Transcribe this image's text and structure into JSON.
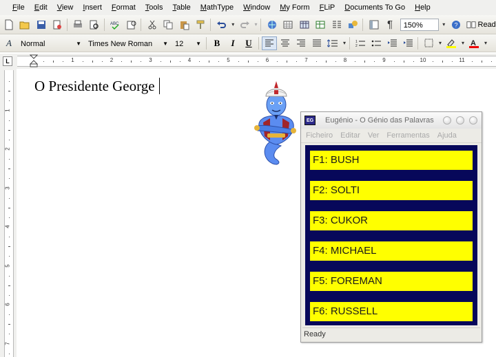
{
  "menubar": {
    "items": [
      "File",
      "Edit",
      "View",
      "Insert",
      "Format",
      "Tools",
      "Table",
      "MathType",
      "Window",
      "My Form",
      "FLiP",
      "Documents To Go",
      "Help"
    ]
  },
  "toolbar": {
    "zoom": "150%",
    "read_label": "Read",
    "icons": [
      "new-icon",
      "open-icon",
      "save-icon",
      "permission-icon",
      "print-icon",
      "print-preview-icon",
      "spelling-icon",
      "research-icon",
      "cut-icon",
      "copy-icon",
      "paste-icon",
      "format-painter-icon",
      "undo-icon",
      "redo-icon",
      "hyperlink-icon",
      "tables-borders-icon",
      "insert-table-icon",
      "insert-excel-icon",
      "columns-icon",
      "drawing-icon",
      "document-map-icon",
      "show-hide-icon",
      "help-icon"
    ]
  },
  "formatting": {
    "style": "Normal",
    "font": "Times New Roman",
    "size": "12",
    "bold": "B",
    "italic": "I",
    "underline": "U"
  },
  "ruler": {
    "horizontal_numbers": [
      "1",
      "2",
      "3",
      "4",
      "5",
      "6",
      "7",
      "8",
      "9",
      "10",
      "11"
    ],
    "vertical_numbers": [
      "1",
      "2",
      "3",
      "4",
      "5",
      "6",
      "7"
    ]
  },
  "document": {
    "text": "O Presidente George"
  },
  "genio_window": {
    "title": "Eugénio - O Génio das Palavras",
    "icon_text": "EG",
    "menu": [
      "Ficheiro",
      "Editar",
      "Ver",
      "Ferramentas",
      "Ajuda"
    ],
    "suggestions": [
      "F1: BUSH",
      "F2: SOLTI",
      "F3: CUKOR",
      "F4: MICHAEL",
      "F5: FOREMAN",
      "F6: RUSSELL"
    ],
    "status": "Ready",
    "colors": {
      "panel": "#07085a",
      "suggestion_bg": "#ffff00"
    }
  }
}
